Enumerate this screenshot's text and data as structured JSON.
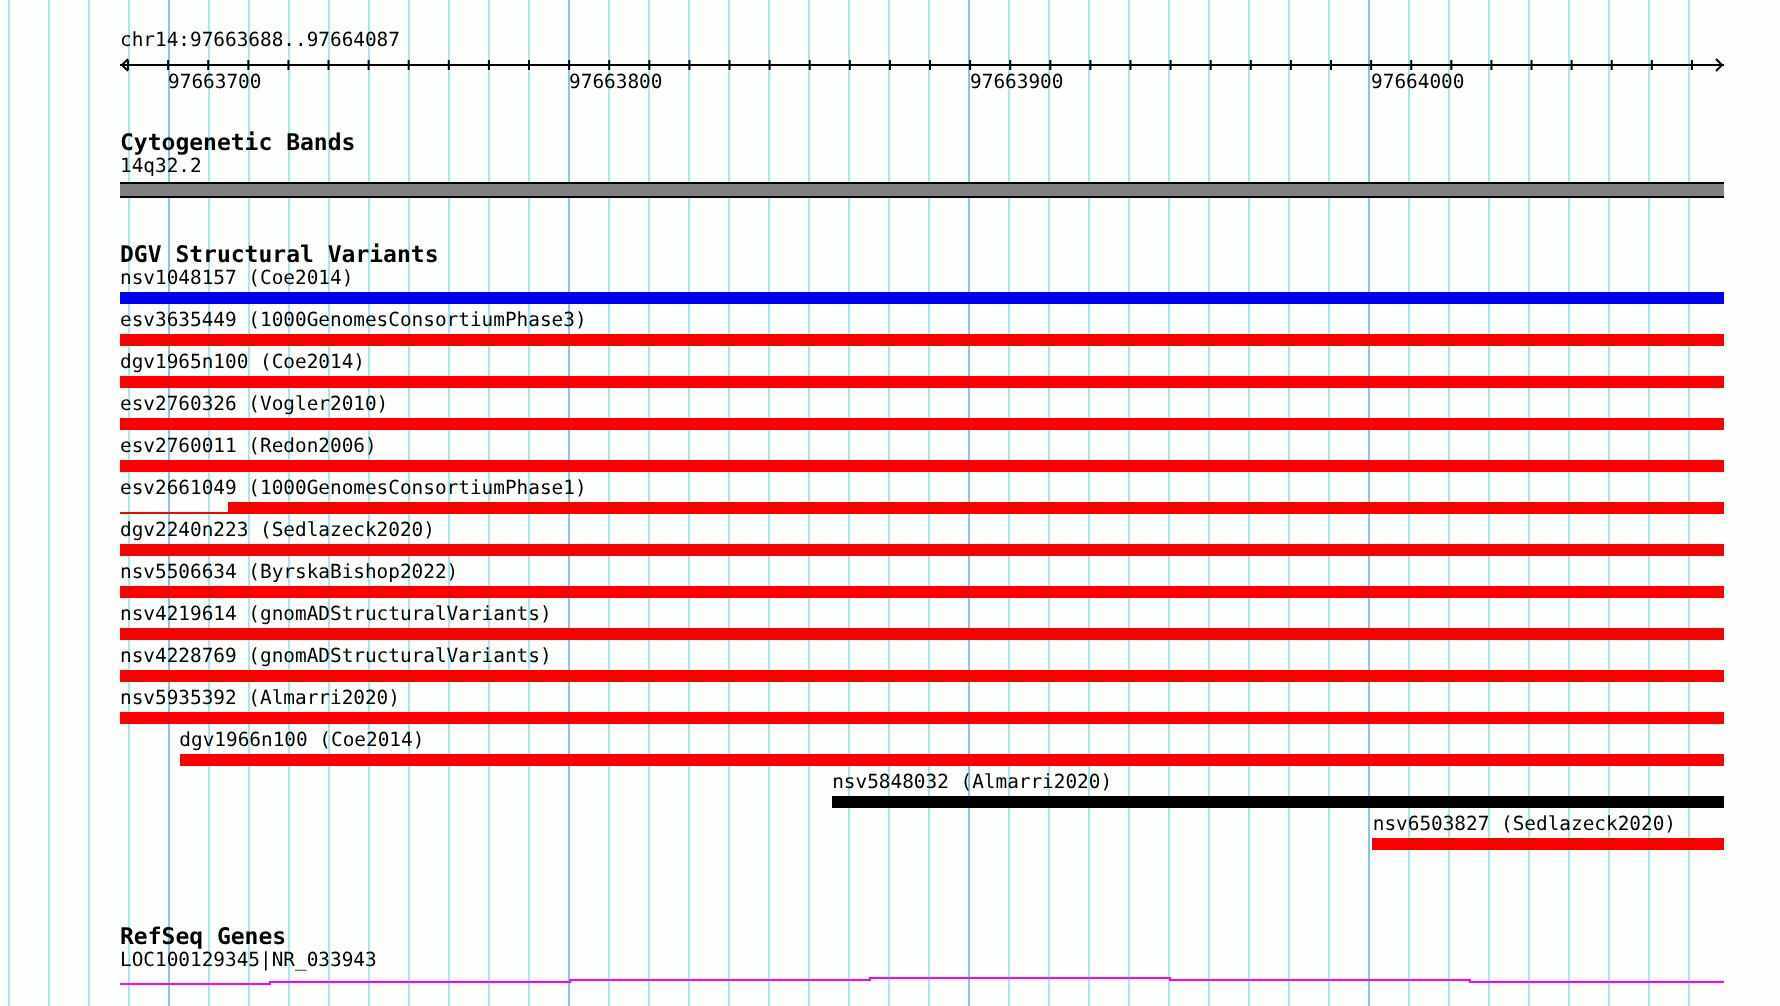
{
  "ruler": {
    "region": "chr14:97663688..97664087",
    "ticks": [
      {
        "label": "97663700"
      },
      {
        "label": "97663800"
      },
      {
        "label": "97663900"
      },
      {
        "label": "97664000"
      }
    ]
  },
  "tracks": [
    {
      "kind": "cytoband",
      "title": "Cytogenetic Bands",
      "features": [
        {
          "label": "14q32.2",
          "kind": "band"
        }
      ]
    },
    {
      "kind": "variants",
      "title": "DGV Structural Variants",
      "features": [
        {
          "label": "nsv1048157 (Coe2014)",
          "kind": "bar",
          "level": 1,
          "color": "#0000ff"
        },
        {
          "label": "esv3635449 (1000GenomesConsortiumPhase3)",
          "kind": "bar",
          "level": 1,
          "color": "#ff0000"
        },
        {
          "label": "dgv1965n100 (Coe2014)",
          "kind": "bar",
          "level": 1,
          "color": "#ff0000"
        },
        {
          "label": "esv2760326 (Vogler2010)",
          "kind": "bar",
          "level": 1,
          "color": "#ff0000"
        },
        {
          "label": "esv2760011 (Redon2006)",
          "kind": "bar",
          "level": 1,
          "color": "#ff0000"
        },
        {
          "label": "esv2661049 (1000GenomesConsortiumPhase1)",
          "kind": "split",
          "level": 0.933,
          "color": "#ff0000"
        },
        {
          "label": "dgv2240n223 (Sedlazeck2020)",
          "kind": "bar",
          "level": 1,
          "color": "#ff0000"
        },
        {
          "label": "nsv5506634 (ByrskaBishop2022)",
          "kind": "bar",
          "level": 1,
          "color": "#ff0000"
        },
        {
          "label": "nsv4219614 (gnomADStructuralVariants)",
          "kind": "bar",
          "level": 1,
          "color": "#ff0000"
        },
        {
          "label": "nsv4228769 (gnomADStructuralVariants)",
          "kind": "bar",
          "level": 1,
          "color": "#ff0000"
        },
        {
          "label": "nsv5935392 (Almarri2020)",
          "kind": "bar",
          "level": 1,
          "color": "#ff0000"
        },
        {
          "label": "dgv1966n100 (Coe2014)",
          "kind": "bar",
          "level": 0.963,
          "color": "#ff0000"
        },
        {
          "label": "nsv5848032 (Almarri2020)",
          "kind": "bar",
          "level": 0.556,
          "color": "#000000"
        },
        {
          "label": "nsv6503827 (Sedlazeck2020)",
          "kind": "bar",
          "level": 0.219,
          "color": "#ff0000"
        }
      ]
    },
    {
      "kind": "genes",
      "title": "RefSeq Genes",
      "features": [
        {
          "label": "LOC100129345|NR_033943",
          "kind": "transcript"
        }
      ]
    }
  ]
}
